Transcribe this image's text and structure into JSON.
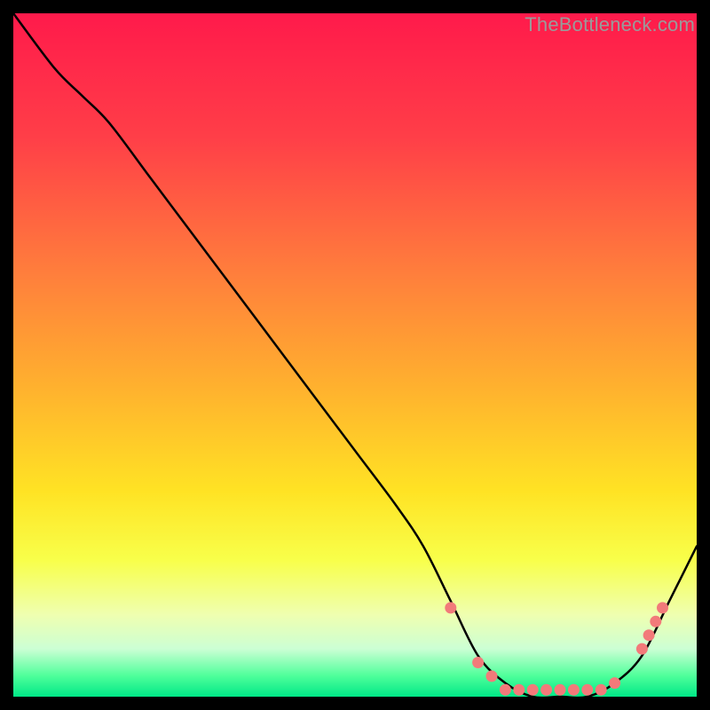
{
  "watermark": "TheBottleneck.com",
  "chart_data": {
    "type": "line",
    "title": "",
    "xlabel": "",
    "ylabel": "",
    "xlim": [
      0,
      100
    ],
    "ylim": [
      0,
      100
    ],
    "gradient_stops": [
      {
        "offset": 0,
        "color": "#ff1a4b"
      },
      {
        "offset": 18,
        "color": "#ff3e48"
      },
      {
        "offset": 38,
        "color": "#ff7e3c"
      },
      {
        "offset": 55,
        "color": "#ffb22e"
      },
      {
        "offset": 70,
        "color": "#ffe324"
      },
      {
        "offset": 80,
        "color": "#f8ff4a"
      },
      {
        "offset": 88,
        "color": "#efffb0"
      },
      {
        "offset": 93,
        "color": "#ccffd4"
      },
      {
        "offset": 97,
        "color": "#4dff9a"
      },
      {
        "offset": 100,
        "color": "#00e887"
      }
    ],
    "series": [
      {
        "name": "bottleneck-curve",
        "x": [
          0,
          6,
          10,
          14,
          20,
          26,
          32,
          38,
          44,
          50,
          56,
          60,
          64,
          68,
          72,
          76,
          80,
          84,
          88,
          92,
          96,
          100
        ],
        "y": [
          100,
          92,
          88,
          84,
          76,
          68,
          60,
          52,
          44,
          36,
          28,
          22,
          14,
          6,
          2,
          0,
          0,
          0,
          2,
          6,
          14,
          22
        ]
      }
    ],
    "markers": {
      "name": "highlight-points",
      "color": "#f27a7a",
      "x": [
        64,
        68,
        70,
        72,
        74,
        76,
        78,
        80,
        82,
        84,
        86,
        88,
        92,
        93,
        94,
        95
      ],
      "y": [
        13,
        5,
        3,
        1,
        1,
        1,
        1,
        1,
        1,
        1,
        1,
        2,
        7,
        9,
        11,
        13
      ]
    }
  }
}
